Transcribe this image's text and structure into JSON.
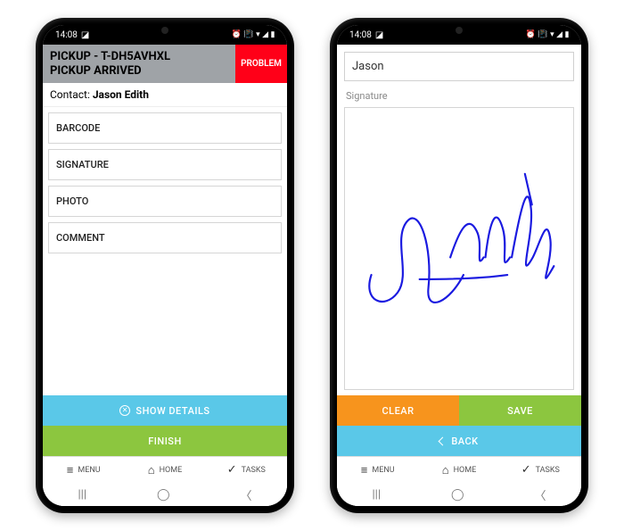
{
  "statusbar": {
    "time": "14:08"
  },
  "left": {
    "header_line1": "PICKUP - T-DH5AVHXL",
    "header_line2": "PICKUP ARRIVED",
    "problem_label": "PROBLEM",
    "contact_label": "Contact:",
    "contact_name": "Jason Edith",
    "items": [
      {
        "label": "BARCODE"
      },
      {
        "label": "SIGNATURE"
      },
      {
        "label": "PHOTO"
      },
      {
        "label": "COMMENT"
      }
    ],
    "show_details_label": "SHOW DETAILS",
    "finish_label": "FINISH"
  },
  "right": {
    "name_value": "Jason",
    "signature_label": "Signature",
    "clear_label": "CLEAR",
    "save_label": "SAVE",
    "back_label": "BACK"
  },
  "bottomnav": {
    "menu": "MENU",
    "home": "HOME",
    "tasks": "TASKS"
  }
}
